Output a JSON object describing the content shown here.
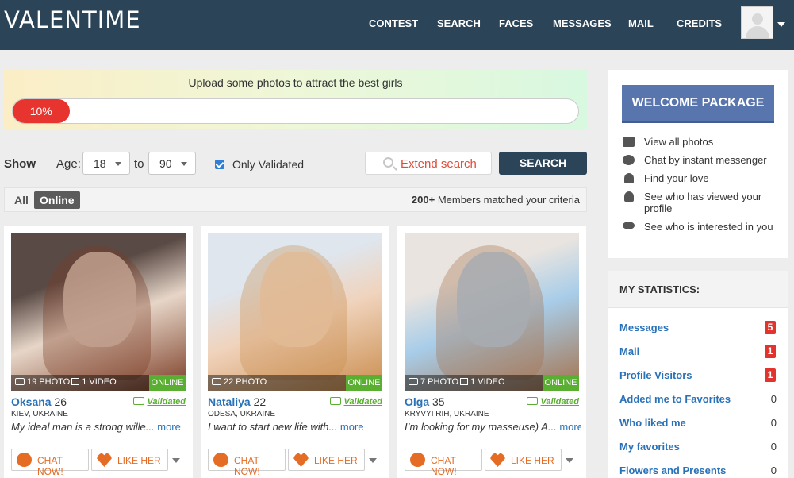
{
  "header": {
    "logo": "VALENTIME",
    "nav": [
      "CONTEST",
      "SEARCH",
      "FACES",
      "MESSAGES",
      "MAIL",
      "CREDITS"
    ]
  },
  "upload": {
    "text": "Upload some photos to attract the best girls",
    "progress_label": "10%",
    "progress_pct": 10
  },
  "filter": {
    "show": "Show",
    "age": "Age:",
    "age_from": "18",
    "to": "to",
    "age_to": "90",
    "only_validated": "Only Validated",
    "extend_search": "Extend search",
    "search": "SEARCH"
  },
  "tabs": {
    "all": "All",
    "online": "Online",
    "matched_count": "200+",
    "matched_text": " Members matched your criteria"
  },
  "cards": [
    {
      "name": "Oksana",
      "age": "26",
      "media": "19 PHOTO",
      "video": "1 VIDEO",
      "status": "ONLINE",
      "validated": "Validated",
      "location": "KIEV, UKRAINE",
      "bio": "My ideal man is a strong wille...",
      "more": "more",
      "chat": "CHAT NOW!",
      "like": "LIKE HER",
      "photo_colors": [
        "#5a4a45",
        "#e7d6c8",
        "#7a3b24"
      ]
    },
    {
      "name": "Nataliya",
      "age": "22",
      "media": "22 PHOTO",
      "video": "",
      "status": "ONLINE",
      "validated": "Validated",
      "location": "ODESA, UKRAINE",
      "bio": "I want to start new life with...",
      "more": "more",
      "chat": "CHAT NOW!",
      "like": "LIKE HER",
      "photo_colors": [
        "#dfe6ee",
        "#f0d3bc",
        "#c98c4c"
      ]
    },
    {
      "name": "Olga",
      "age": "35",
      "media": "7 PHOTO",
      "video": "1 VIDEO",
      "status": "ONLINE",
      "validated": "Validated",
      "location": "KRYVYI RIH, UKRAINE",
      "bio": "I’m looking for my masseuse) A...",
      "more": "more",
      "chat": "CHAT NOW!",
      "like": "LIKE HER",
      "photo_colors": [
        "#e9e4df",
        "#a8cde9",
        "#a5714a"
      ]
    }
  ],
  "welcome": {
    "button": "WELCOME PACKAGE",
    "features": [
      {
        "icon": "camera-icon",
        "text": "View all photos"
      },
      {
        "icon": "chat-bubble-icon",
        "text": "Chat by instant messenger"
      },
      {
        "icon": "user-icon",
        "text": "Find your love"
      },
      {
        "icon": "user-icon",
        "text": "See who has viewed your profile"
      },
      {
        "icon": "eye-icon",
        "text": "See who is interested in you"
      }
    ]
  },
  "stats": {
    "title": "MY STATISTICS:",
    "rows": [
      {
        "label": "Messages",
        "value": "5",
        "badge": true
      },
      {
        "label": "Mail",
        "value": "1",
        "badge": true
      },
      {
        "label": "Profile Visitors",
        "value": "1",
        "badge": true
      },
      {
        "label": "Added me to Favorites",
        "value": "0",
        "badge": false
      },
      {
        "label": "Who liked me",
        "value": "0",
        "badge": false
      },
      {
        "label": "My favorites",
        "value": "0",
        "badge": false
      },
      {
        "label": "Flowers and Presents",
        "value": "0",
        "badge": false
      }
    ]
  },
  "colors": {
    "header": "#2b4458",
    "link": "#2a72b8",
    "accent": "#e46c24",
    "online": "#5aae32",
    "badge": "#e2332c",
    "welcome": "#5875ad"
  }
}
